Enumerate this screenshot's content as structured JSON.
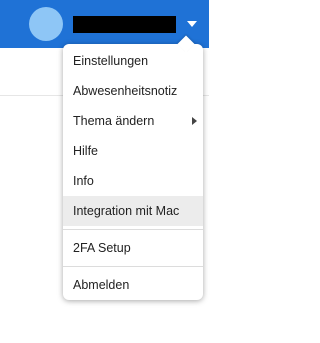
{
  "header": {
    "background_color": "#1f72d6",
    "avatar_color": "#8ec6f6",
    "username_redacted": true,
    "menu_toggle_icon": "chevron-down-icon"
  },
  "menu": {
    "items": [
      {
        "label": "Einstellungen"
      },
      {
        "label": "Abwesenheitsnotiz"
      },
      {
        "label": "Thema ändern",
        "submenu_icon": "chevron-right-icon"
      },
      {
        "label": "Hilfe"
      },
      {
        "label": "Info"
      },
      {
        "label": "Integration mit Mac",
        "highlighted": true
      },
      {
        "label": "2FA Setup"
      },
      {
        "label": "Abmelden"
      }
    ]
  }
}
